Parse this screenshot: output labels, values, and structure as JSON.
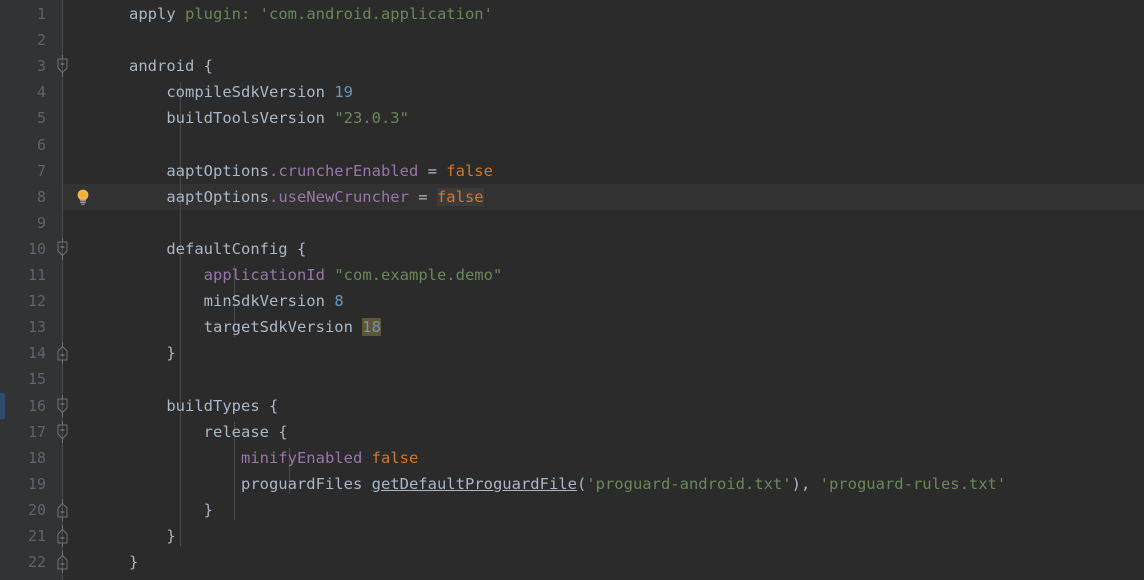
{
  "editor": {
    "kind": "code-editor",
    "language": "gradle-groovy",
    "theme": "darcula",
    "colors": {
      "background": "#2b2b2b",
      "gutter_background": "#313335",
      "gutter_separator": "#4b4e50",
      "line_number": "#606366",
      "caret_line": "#323232",
      "indent_guide": "#4a4a4a",
      "vcs_changed_marker": "#2f4a6d",
      "selection_highlight": "#5f5632",
      "occurrence_highlight": "#3b3b3b",
      "default_text": "#a9b7c6",
      "keyword": "#cc7832",
      "string": "#6a8759",
      "number": "#6897bb",
      "field": "#9876aa",
      "label": "#6a8759",
      "bulb": "#f5b544"
    },
    "gutter_icons": {
      "intention_bulb": "lightbulb-icon",
      "fold_open": "fold-expanded-icon",
      "fold_close": "fold-end-icon"
    },
    "caret_line_number": 8,
    "selected_text": "18",
    "selection_line": 13,
    "vcs_changed_lines": [
      16
    ],
    "lines": [
      {
        "n": 1,
        "fold": null,
        "bulb": false,
        "indents": [],
        "tokens": [
          {
            "text": "apply ",
            "cls": "t-default"
          },
          {
            "text": "plugin: ",
            "cls": "t-label"
          },
          {
            "text": "'com.android.application'",
            "cls": "t-string"
          }
        ]
      },
      {
        "n": 2,
        "fold": null,
        "bulb": false,
        "indents": [],
        "tokens": []
      },
      {
        "n": 3,
        "fold": "open",
        "bulb": false,
        "indents": [],
        "tokens": [
          {
            "text": "android ",
            "cls": "t-default"
          },
          {
            "text": "{",
            "cls": "t-brace"
          }
        ]
      },
      {
        "n": 4,
        "fold": null,
        "bulb": false,
        "indents": [
          0
        ],
        "tokens": [
          {
            "text": "    compileSdkVersion ",
            "cls": "t-default"
          },
          {
            "text": "19",
            "cls": "t-number"
          }
        ]
      },
      {
        "n": 5,
        "fold": null,
        "bulb": false,
        "indents": [
          0
        ],
        "tokens": [
          {
            "text": "    buildToolsVersion ",
            "cls": "t-default"
          },
          {
            "text": "\"23.0.3\"",
            "cls": "t-string"
          }
        ]
      },
      {
        "n": 6,
        "fold": null,
        "bulb": false,
        "indents": [
          0
        ],
        "tokens": []
      },
      {
        "n": 7,
        "fold": null,
        "bulb": false,
        "indents": [
          0
        ],
        "tokens": [
          {
            "text": "    aaptOptions",
            "cls": "t-default"
          },
          {
            "text": ".cruncherEnabled",
            "cls": "t-field"
          },
          {
            "text": " = ",
            "cls": "t-op"
          },
          {
            "text": "false",
            "cls": "t-keyword"
          }
        ]
      },
      {
        "n": 8,
        "fold": null,
        "bulb": true,
        "indents": [
          0
        ],
        "tokens": [
          {
            "text": "    aaptOptions",
            "cls": "t-default"
          },
          {
            "text": ".useNewCruncher",
            "cls": "t-field"
          },
          {
            "text": " = ",
            "cls": "t-op"
          },
          {
            "text": "false",
            "cls": "t-keyword occ-hl"
          }
        ]
      },
      {
        "n": 9,
        "fold": null,
        "bulb": false,
        "indents": [
          0
        ],
        "tokens": []
      },
      {
        "n": 10,
        "fold": "open",
        "bulb": false,
        "indents": [
          0
        ],
        "tokens": [
          {
            "text": "    defaultConfig ",
            "cls": "t-default"
          },
          {
            "text": "{",
            "cls": "t-brace"
          }
        ]
      },
      {
        "n": 11,
        "fold": null,
        "bulb": false,
        "indents": [
          0,
          1
        ],
        "tokens": [
          {
            "text": "        ",
            "cls": "t-default"
          },
          {
            "text": "applicationId",
            "cls": "t-field"
          },
          {
            "text": " ",
            "cls": "t-default"
          },
          {
            "text": "\"com.example.demo\"",
            "cls": "t-string"
          }
        ]
      },
      {
        "n": 12,
        "fold": null,
        "bulb": false,
        "indents": [
          0,
          1
        ],
        "tokens": [
          {
            "text": "        minSdkVersion ",
            "cls": "t-default"
          },
          {
            "text": "8",
            "cls": "t-number"
          }
        ]
      },
      {
        "n": 13,
        "fold": null,
        "bulb": false,
        "indents": [
          0,
          1
        ],
        "tokens": [
          {
            "text": "        targetSdkVersion ",
            "cls": "t-default"
          },
          {
            "text": "18",
            "cls": "t-number sel-hl"
          }
        ]
      },
      {
        "n": 14,
        "fold": "close",
        "bulb": false,
        "indents": [
          0
        ],
        "tokens": [
          {
            "text": "    }",
            "cls": "t-brace"
          }
        ]
      },
      {
        "n": 15,
        "fold": null,
        "bulb": false,
        "indents": [
          0
        ],
        "tokens": []
      },
      {
        "n": 16,
        "fold": "open",
        "bulb": false,
        "indents": [
          0
        ],
        "tokens": [
          {
            "text": "    buildTypes ",
            "cls": "t-default"
          },
          {
            "text": "{",
            "cls": "t-brace"
          }
        ]
      },
      {
        "n": 17,
        "fold": "open",
        "bulb": false,
        "indents": [
          0,
          1
        ],
        "tokens": [
          {
            "text": "        release ",
            "cls": "t-default"
          },
          {
            "text": "{",
            "cls": "t-brace"
          }
        ]
      },
      {
        "n": 18,
        "fold": null,
        "bulb": false,
        "indents": [
          0,
          1,
          2
        ],
        "tokens": [
          {
            "text": "            ",
            "cls": "t-default"
          },
          {
            "text": "minifyEnabled",
            "cls": "t-field"
          },
          {
            "text": " ",
            "cls": "t-default"
          },
          {
            "text": "false",
            "cls": "t-keyword"
          }
        ]
      },
      {
        "n": 19,
        "fold": null,
        "bulb": false,
        "indents": [
          0,
          1,
          2
        ],
        "tokens": [
          {
            "text": "            proguardFiles ",
            "cls": "t-default"
          },
          {
            "text": "getDefaultProguardFile",
            "cls": "t-method"
          },
          {
            "text": "(",
            "cls": "t-brace"
          },
          {
            "text": "'proguard-android.txt'",
            "cls": "t-string"
          },
          {
            "text": ")",
            "cls": "t-brace"
          },
          {
            "text": ", ",
            "cls": "t-op"
          },
          {
            "text": "'proguard-rules.txt'",
            "cls": "t-string"
          }
        ]
      },
      {
        "n": 20,
        "fold": "close",
        "bulb": false,
        "indents": [
          0,
          1
        ],
        "tokens": [
          {
            "text": "        }",
            "cls": "t-brace"
          }
        ]
      },
      {
        "n": 21,
        "fold": "close",
        "bulb": false,
        "indents": [
          0
        ],
        "tokens": [
          {
            "text": "    }",
            "cls": "t-brace"
          }
        ]
      },
      {
        "n": 22,
        "fold": "close",
        "bulb": false,
        "indents": [],
        "tokens": [
          {
            "text": "}",
            "cls": "t-brace"
          }
        ]
      }
    ]
  }
}
